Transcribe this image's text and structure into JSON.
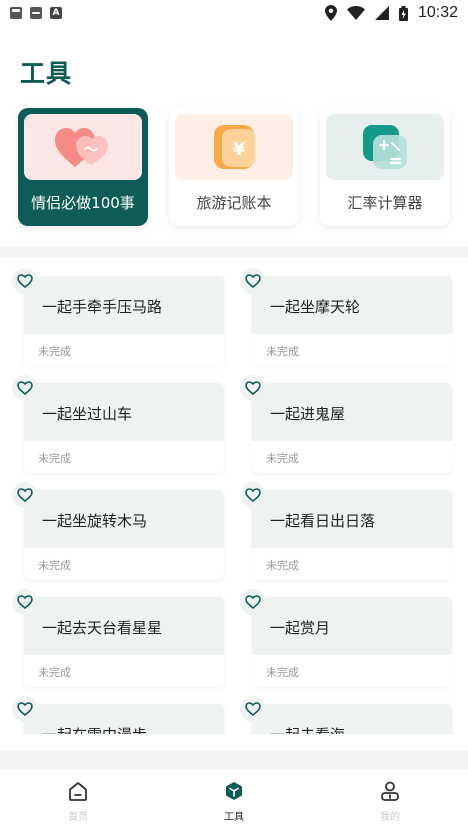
{
  "status_bar": {
    "time": "10:32",
    "icons": [
      "notification-icon",
      "notification-icon",
      "app-a-icon",
      "location-icon",
      "wifi-icon",
      "signal-icon",
      "battery-icon"
    ]
  },
  "page": {
    "title": "工具"
  },
  "tools": [
    {
      "label": "情侣必做100事",
      "icon": "hearts-icon",
      "active": true
    },
    {
      "label": "旅游记账本",
      "icon": "yen-wallet-icon",
      "active": false
    },
    {
      "label": "汇率计算器",
      "icon": "calculator-icon",
      "active": false
    }
  ],
  "items": [
    {
      "title": "一起手牵手压马路",
      "status": "未完成"
    },
    {
      "title": "一起坐摩天轮",
      "status": "未完成"
    },
    {
      "title": "一起坐过山车",
      "status": "未完成"
    },
    {
      "title": "一起进鬼屋",
      "status": "未完成"
    },
    {
      "title": "一起坐旋转木马",
      "status": "未完成"
    },
    {
      "title": "一起看日出日落",
      "status": "未完成"
    },
    {
      "title": "一起去天台看星星",
      "status": "未完成"
    },
    {
      "title": "一起赏月",
      "status": "未完成"
    },
    {
      "title": "一起在雪中漫步",
      "status": ""
    },
    {
      "title": "一起去看海",
      "status": ""
    }
  ],
  "nav": [
    {
      "label": "首页",
      "icon": "home-icon",
      "active": false
    },
    {
      "label": "工具",
      "icon": "cube-icon",
      "active": true
    },
    {
      "label": "我的",
      "icon": "profile-icon",
      "active": false
    }
  ],
  "colors": {
    "accent": "#0e5c58",
    "card_bg": "#eef2f1",
    "muted": "#999999"
  }
}
